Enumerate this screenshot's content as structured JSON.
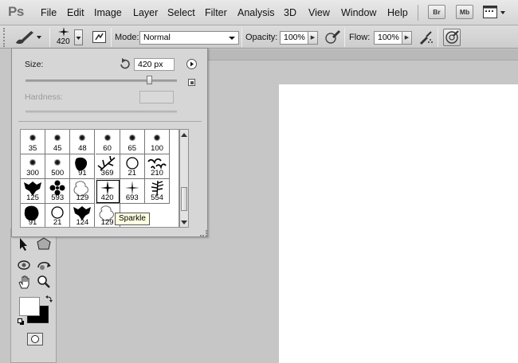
{
  "app": {
    "logo": "Ps"
  },
  "menu": [
    "File",
    "Edit",
    "Image",
    "Layer",
    "Select",
    "Filter",
    "Analysis",
    "3D",
    "View",
    "Window",
    "Help"
  ],
  "app_buttons": {
    "bridge": "Br",
    "mini_bridge": "Mb"
  },
  "options": {
    "brush_size": "420",
    "mode_label": "Mode:",
    "mode_value": "Normal",
    "opacity_label": "Opacity:",
    "opacity_value": "100%",
    "flow_label": "Flow:",
    "flow_value": "100%"
  },
  "brush_picker": {
    "size_label": "Size:",
    "size_value": "420 px",
    "size_fraction": 0.82,
    "hardness_label": "Hardness:"
  },
  "brushes": [
    {
      "size": "35",
      "shape": "soft"
    },
    {
      "size": "45",
      "shape": "soft"
    },
    {
      "size": "48",
      "shape": "soft"
    },
    {
      "size": "60",
      "shape": "soft"
    },
    {
      "size": "65",
      "shape": "soft"
    },
    {
      "size": "100",
      "shape": "soft"
    },
    {
      "size": "300",
      "shape": "soft"
    },
    {
      "size": "500",
      "shape": "soft"
    },
    {
      "size": "91",
      "shape": "leaf"
    },
    {
      "size": "369",
      "shape": "grass"
    },
    {
      "size": "21",
      "shape": "ring"
    },
    {
      "size": "210",
      "shape": "birds"
    },
    {
      "size": "125",
      "shape": "ivy"
    },
    {
      "size": "593",
      "shape": "flower"
    },
    {
      "size": "129",
      "shape": "foil"
    },
    {
      "size": "420",
      "shape": "sparkle",
      "selected": true
    },
    {
      "size": "693",
      "shape": "star"
    },
    {
      "size": "554",
      "shape": "fern"
    },
    {
      "size": "91",
      "shape": "blob"
    },
    {
      "size": "21",
      "shape": "ring"
    },
    {
      "size": "124",
      "shape": "ivy"
    },
    {
      "size": "129",
      "shape": "foil"
    }
  ],
  "tooltip": "Sparkle",
  "colors": {
    "foreground": "#ffffff",
    "background": "#000000"
  }
}
